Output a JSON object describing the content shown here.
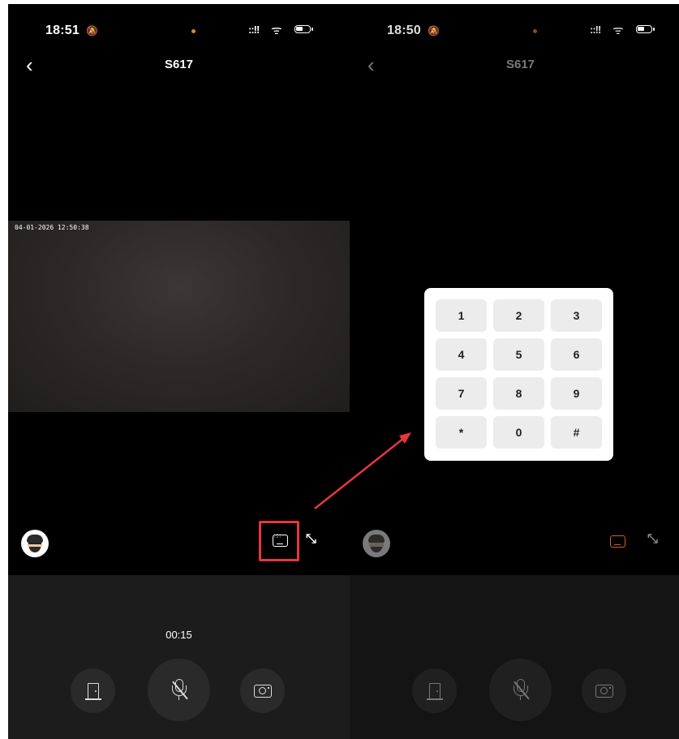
{
  "left_screen": {
    "status": {
      "time": "18:51",
      "bell": "🔕",
      "signal": "::!!",
      "wifi": "ᯤ"
    },
    "title": "S617",
    "video": {
      "timestamp": "04-01-2026 12:50:38"
    },
    "call": {
      "timer": "00:15"
    },
    "icons": {
      "back": "‹",
      "expand": "⤡"
    }
  },
  "right_screen": {
    "status": {
      "time": "18:50",
      "bell": "🔕",
      "signal": "::!!",
      "wifi": "ᯤ"
    },
    "title": "S617",
    "icons": {
      "back": "‹",
      "expand": "⤡"
    },
    "keypad": {
      "keys": [
        "1",
        "2",
        "3",
        "4",
        "5",
        "6",
        "7",
        "8",
        "9",
        "*",
        "0",
        "#"
      ]
    }
  },
  "colors": {
    "highlight": "#e8363d",
    "accent_orange": "#c9642a",
    "background": "#000000"
  }
}
